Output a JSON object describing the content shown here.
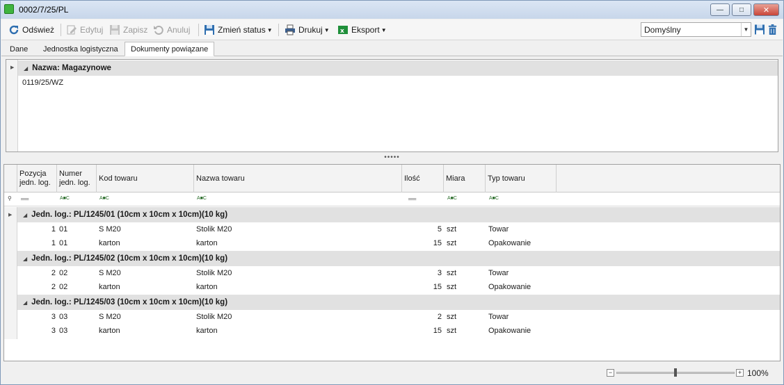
{
  "window": {
    "title": "0002/7/25/PL"
  },
  "toolbar": {
    "refresh": "Odśwież",
    "edit": "Edytuj",
    "save": "Zapisz",
    "cancel": "Anuluj",
    "change_status": "Zmień status",
    "print": "Drukuj",
    "export": "Eksport",
    "layout_value": "Domyślny"
  },
  "tabs": [
    "Dane",
    "Jednostka logistyczna",
    "Dokumenty powiązane"
  ],
  "active_tab": "Dokumenty powiązane",
  "top_grid": {
    "group": "Nazwa: Magazynowe",
    "rows": [
      "0119/25/WZ"
    ]
  },
  "bottom_grid": {
    "columns": {
      "pos": "Pozycja jedn. log.",
      "num": "Numer jedn. log.",
      "code": "Kod towaru",
      "name": "Nazwa towaru",
      "qty": "Ilość",
      "unit": "Miara",
      "type": "Typ towaru"
    },
    "groups": [
      {
        "label": "Jedn. log.: PL/1245/01 (10cm x 10cm x 10cm)(10 kg)",
        "rows": [
          {
            "pos": "1",
            "num": "01",
            "code": "S M20",
            "name": "Stolik M20",
            "qty": "5",
            "unit": "szt",
            "type": "Towar"
          },
          {
            "pos": "1",
            "num": "01",
            "code": "karton",
            "name": "karton",
            "qty": "15",
            "unit": "szt",
            "type": "Opakowanie"
          }
        ]
      },
      {
        "label": "Jedn. log.: PL/1245/02 (10cm x 10cm x 10cm)(10 kg)",
        "rows": [
          {
            "pos": "2",
            "num": "02",
            "code": "S M20",
            "name": "Stolik M20",
            "qty": "3",
            "unit": "szt",
            "type": "Towar"
          },
          {
            "pos": "2",
            "num": "02",
            "code": "karton",
            "name": "karton",
            "qty": "15",
            "unit": "szt",
            "type": "Opakowanie"
          }
        ]
      },
      {
        "label": "Jedn. log.: PL/1245/03 (10cm x 10cm x 10cm)(10 kg)",
        "rows": [
          {
            "pos": "3",
            "num": "03",
            "code": "S M20",
            "name": "Stolik M20",
            "qty": "2",
            "unit": "szt",
            "type": "Towar"
          },
          {
            "pos": "3",
            "num": "03",
            "code": "karton",
            "name": "karton",
            "qty": "15",
            "unit": "szt",
            "type": "Opakowanie"
          }
        ]
      }
    ]
  },
  "status": {
    "zoom": "100%"
  },
  "colors": {
    "accent": "#2f6fb0",
    "excel": "#1f8f3a",
    "group_bg": "#e1e1e1"
  }
}
